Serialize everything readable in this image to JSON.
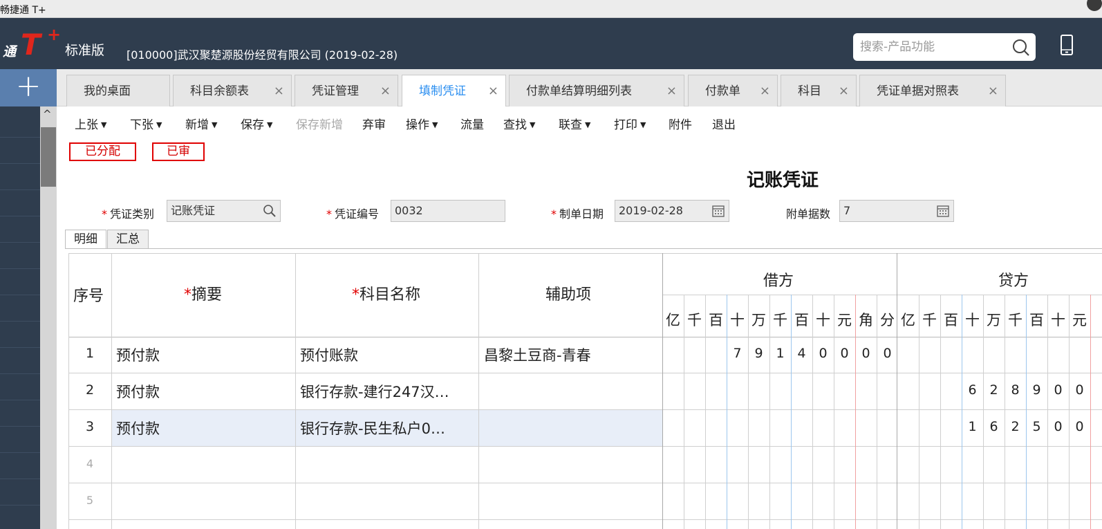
{
  "window": {
    "title": "畅捷通 T+"
  },
  "header": {
    "logo_prefix": "通",
    "logo_t": "T",
    "logo_plus": "+",
    "edition": "标准版",
    "company": "[010000]武汉聚楚源股份经贸有限公司   (2019-02-28)",
    "search_placeholder": "搜索-产品功能"
  },
  "sidebar": {
    "add_label": "+",
    "scroll_up": "^"
  },
  "tabs": [
    {
      "label": "我的桌面",
      "closable": false
    },
    {
      "label": "科目余额表",
      "closable": true
    },
    {
      "label": "凭证管理",
      "closable": true
    },
    {
      "label": "填制凭证",
      "closable": true,
      "active": true
    },
    {
      "label": "付款单结算明细列表",
      "closable": true
    },
    {
      "label": "付款单",
      "closable": true
    },
    {
      "label": "科目",
      "closable": true
    },
    {
      "label": "凭证单据对照表",
      "closable": true
    }
  ],
  "toolbar": [
    {
      "label": "上张",
      "dropdown": true
    },
    {
      "label": "下张",
      "dropdown": true
    },
    {
      "label": "新增",
      "dropdown": true
    },
    {
      "label": "保存",
      "dropdown": true
    },
    {
      "label": "保存新增",
      "disabled": true
    },
    {
      "label": "弃审"
    },
    {
      "label": "操作",
      "dropdown": true
    },
    {
      "label": "流量"
    },
    {
      "label": "查找",
      "dropdown": true
    },
    {
      "label": "联查",
      "dropdown": true
    },
    {
      "label": "打印",
      "dropdown": true
    },
    {
      "label": "附件"
    },
    {
      "label": "退出"
    }
  ],
  "stamps": [
    "已分配",
    "已审"
  ],
  "voucher": {
    "title": "记账凭证",
    "type_label": "凭证类别",
    "type_value": "记账凭证",
    "number_label": "凭证编号",
    "number_value": "0032",
    "date_label": "制单日期",
    "date_value": "2019-02-28",
    "attach_label": "附单据数",
    "attach_value": "7"
  },
  "subtabs": [
    "明细",
    "汇总"
  ],
  "grid": {
    "headers": {
      "seq": "序号",
      "summary": "摘要",
      "account": "科目名称",
      "aux": "辅助项",
      "debit": "借方",
      "credit": "贷方",
      "required_mark": "*"
    },
    "debit_units": [
      "亿",
      "千",
      "百",
      "十",
      "万",
      "千",
      "百",
      "十",
      "元",
      "角",
      "分"
    ],
    "credit_units": [
      "亿",
      "千",
      "百",
      "十",
      "万",
      "千",
      "百",
      "十",
      "元"
    ],
    "rows": [
      {
        "seq": "1",
        "summary": "预付款",
        "account": "预付账款",
        "aux": "昌黎土豆商-青春",
        "debit_digits": [
          "",
          "",
          "",
          "7",
          "9",
          "1",
          "4",
          "0",
          "0",
          "0",
          "0"
        ],
        "credit_digits": [
          "",
          "",
          "",
          "",
          "",
          "",
          "",
          "",
          ""
        ]
      },
      {
        "seq": "2",
        "summary": "预付款",
        "account": "银行存款-建行247汉…",
        "aux": "",
        "debit_digits": [
          "",
          "",
          "",
          "",
          "",
          "",
          "",
          "",
          "",
          "",
          ""
        ],
        "credit_digits": [
          "",
          "",
          "",
          "6",
          "2",
          "8",
          "9",
          "0",
          "0"
        ]
      },
      {
        "seq": "3",
        "summary": "预付款",
        "account": "银行存款-民生私户0…",
        "aux": "",
        "debit_digits": [
          "",
          "",
          "",
          "",
          "",
          "",
          "",
          "",
          "",
          "",
          ""
        ],
        "credit_digits": [
          "",
          "",
          "",
          "1",
          "6",
          "2",
          "5",
          "0",
          "0"
        ]
      },
      {
        "seq": "4",
        "summary": "",
        "account": "",
        "aux": "",
        "debit_digits": [],
        "credit_digits": []
      },
      {
        "seq": "5",
        "summary": "",
        "account": "",
        "aux": "",
        "debit_digits": [],
        "credit_digits": []
      }
    ]
  },
  "colors": {
    "header_bg": "#2f3d4e",
    "accent": "#2a8ef0",
    "logo_red": "#e0261c",
    "stamp_red": "#e00000",
    "selected_row": "#e8eef8"
  }
}
